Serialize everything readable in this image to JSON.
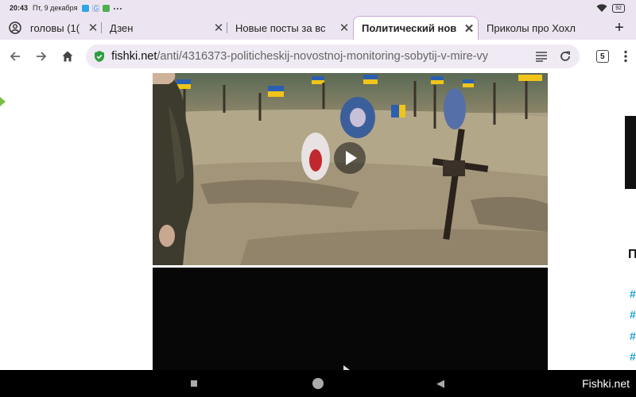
{
  "status_bar": {
    "time": "20:43",
    "date": "Пт, 9 декабря",
    "notification_icons": [
      "telegram-icon",
      "google-icon",
      "gallery-icon",
      "more-dots-icon"
    ],
    "battery": "92",
    "system_icons": [
      "wifi-icon",
      "battery-icon"
    ]
  },
  "tabs": [
    {
      "label": "головы (1(",
      "active": false
    },
    {
      "label": "Дзен",
      "active": false
    },
    {
      "label": "Новые посты за вс",
      "active": false
    },
    {
      "label": "Политический нов",
      "active": true
    },
    {
      "label": "Приколы про Хохл",
      "active": false
    }
  ],
  "toolbar": {
    "url_domain": "fishki.net",
    "url_path": "/anti/4316373-politicheskij-novostnoj-monitoring-sobytij-v-mire-vy",
    "tab_count": "5"
  },
  "page": {
    "side_heading": "П",
    "side_tags": [
      "#",
      "#",
      "#",
      "#"
    ]
  },
  "navbar": {
    "watermark": "Fishki.net"
  },
  "colors": {
    "chrome_bg": "#ece5f1",
    "omnibox_bg": "#efeaf4",
    "secure_icon": "#2e9e3f",
    "link_accent": "#1a9fd3",
    "active_tab_border": "#c8a8d8"
  }
}
